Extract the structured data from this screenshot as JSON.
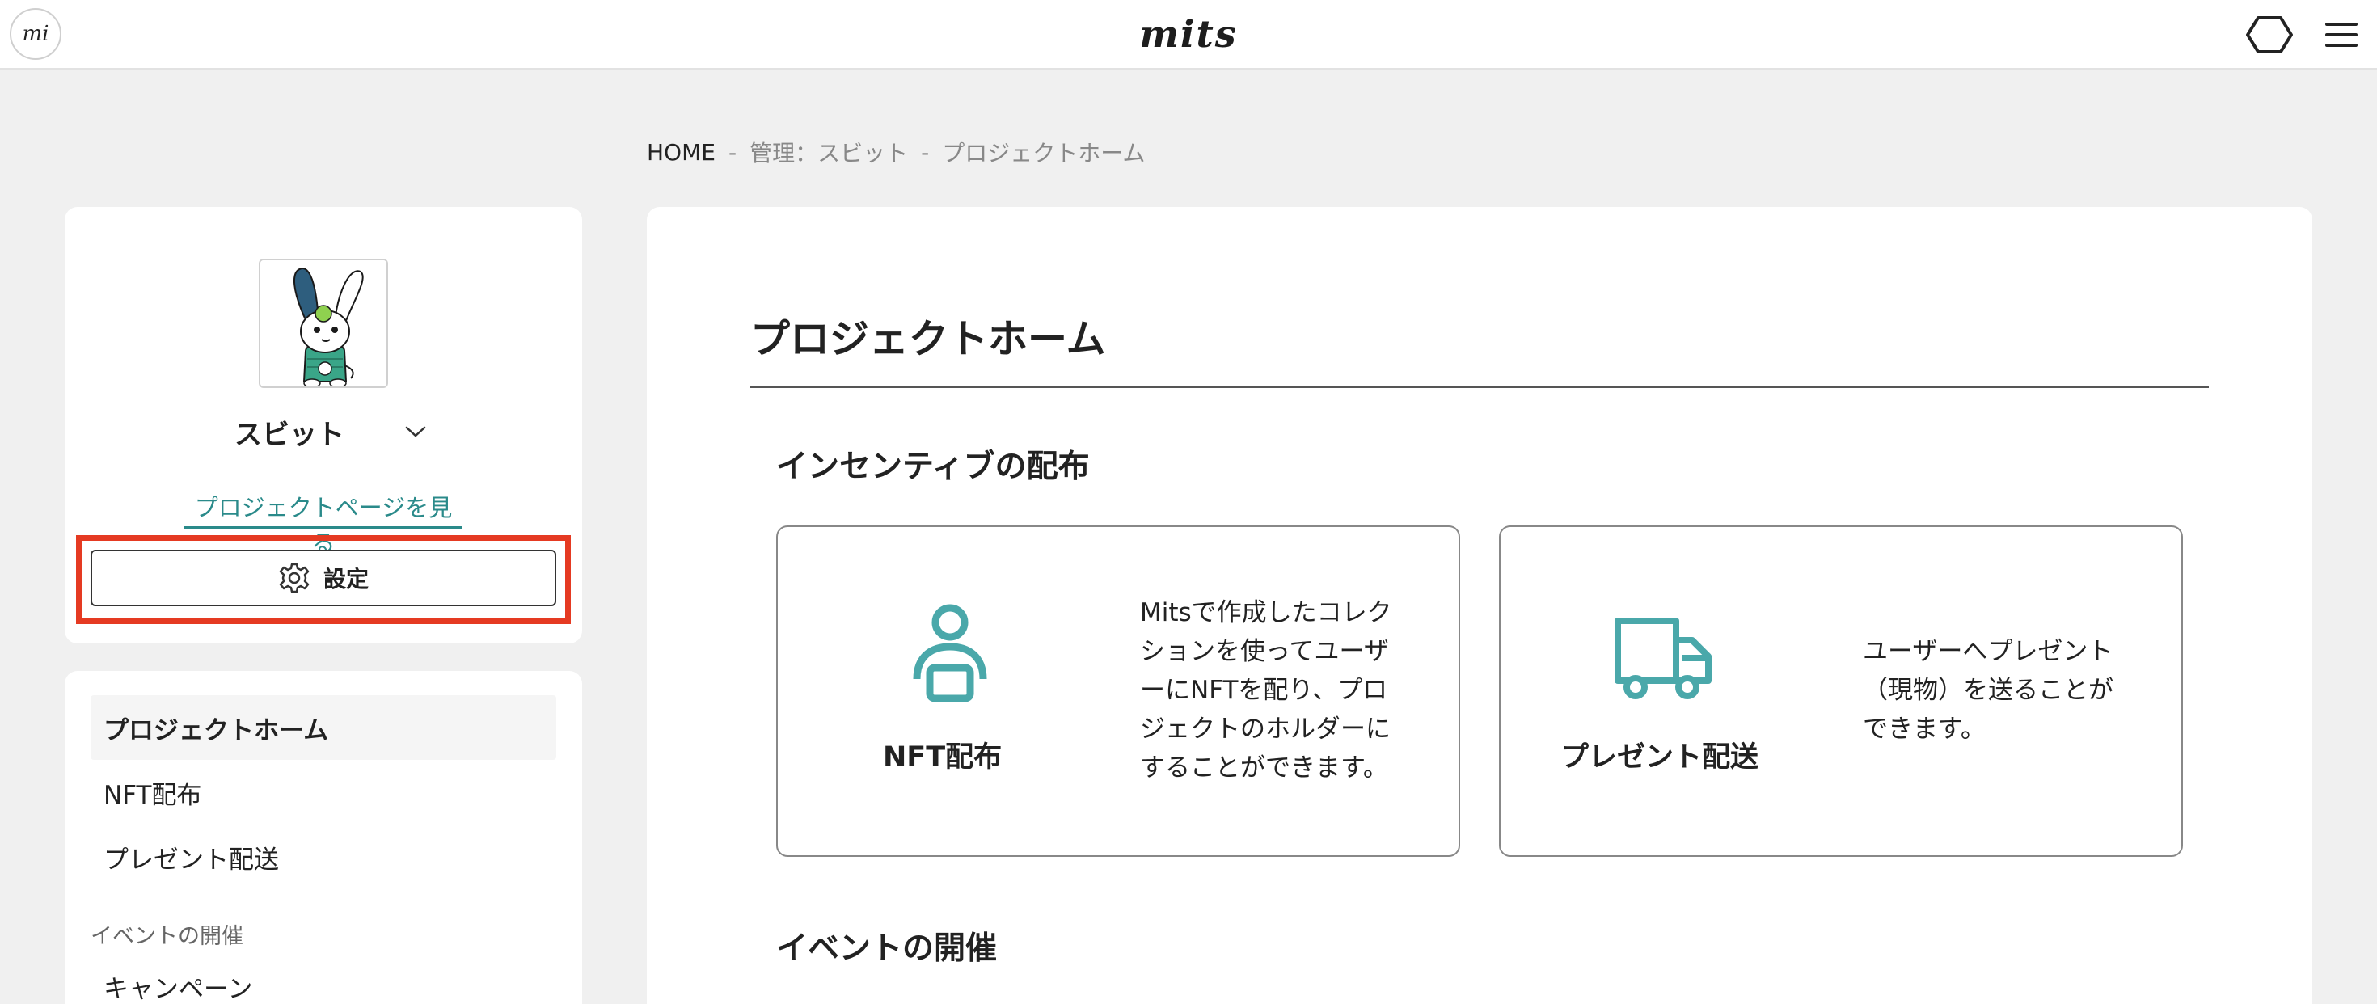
{
  "header": {
    "logo": "mits",
    "avatar_text": "mi",
    "icons": {
      "hex": "hexagon-icon",
      "menu": "hamburger-menu-icon"
    }
  },
  "breadcrumb": {
    "items": [
      "HOME",
      "管理：スビット",
      "プロジェクトホーム"
    ],
    "separator": "-"
  },
  "project": {
    "name": "スビット",
    "link_label": "プロジェクトページを見る",
    "settings_label": "設定"
  },
  "nav": {
    "items": [
      "プロジェクトホーム",
      "NFT配布",
      "プレゼント配送"
    ],
    "active_index": 0,
    "section_label": "イベントの開催",
    "section_items": [
      "キャンペーン"
    ]
  },
  "main": {
    "title": "プロジェクトホーム",
    "sections": [
      {
        "title": "インセンティブの配布",
        "cards": [
          {
            "icon": "person-icon",
            "title": "NFT配布",
            "description_lines": [
              "Mitsで作成したコレク",
              "ションを使ってユーザ",
              "ーにNFTを配り、プロ",
              "ジェクトのホルダーに",
              "することができます。"
            ]
          },
          {
            "icon": "truck-icon",
            "title": "プレゼント配送",
            "description_lines": [
              "ユーザーへプレゼント",
              "（現物）を送ることが",
              "できます。"
            ]
          }
        ]
      },
      {
        "title": "イベントの開催"
      }
    ]
  },
  "colors": {
    "accent": "#2a8a8a",
    "icon_teal": "#4aa8aa",
    "highlight": "#e53a22",
    "background": "#f0f0f0"
  }
}
